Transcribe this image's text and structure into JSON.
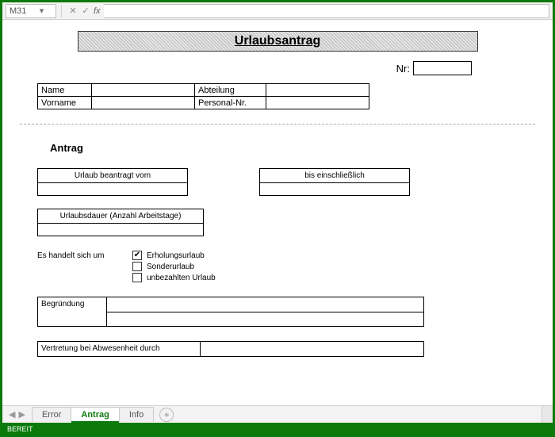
{
  "formula_bar": {
    "cell_ref": "M31",
    "cancel": "✕",
    "accept": "✓",
    "fx_label": "fx",
    "value": ""
  },
  "doc": {
    "title": "Urlaubsantrag",
    "nr_label": "Nr:",
    "nr_value": "",
    "info_labels": {
      "name": "Name",
      "vorname": "Vorname",
      "abteilung": "Abteilung",
      "personalnr": "Personal-Nr."
    },
    "info_values": {
      "name": "",
      "vorname": "",
      "abteilung": "",
      "personalnr": ""
    },
    "antrag_heading": "Antrag",
    "beantragt_label": "Urlaub beantragt vom",
    "beantragt_value": "",
    "bis_label": "bis einschließlich",
    "bis_value": "",
    "dauer_label": "Urlaubsdauer (Anzahl Arbeitstage)",
    "dauer_value": "",
    "es_handelt": "Es handelt sich um",
    "checks": [
      {
        "label": "Erholungsurlaub",
        "checked": true
      },
      {
        "label": "Sonderurlaub",
        "checked": false
      },
      {
        "label": "unbezahlten Urlaub",
        "checked": false
      }
    ],
    "begruendung_label": "Begründung",
    "begruendung_value": "",
    "vertretung_label": "Vertretung bei Abwesenheit durch",
    "vertretung_value": ""
  },
  "tabs": {
    "nav_prev_all": "⏮",
    "nav_prev": "◀",
    "items": [
      {
        "label": "Error",
        "active": false
      },
      {
        "label": "Antrag",
        "active": true
      },
      {
        "label": "Info",
        "active": false
      }
    ],
    "add": "+"
  },
  "status": {
    "text": "BEREIT"
  }
}
